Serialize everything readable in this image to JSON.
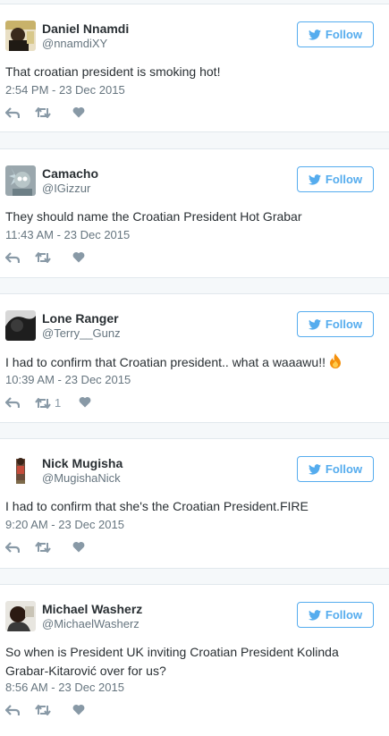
{
  "follow_label": "Follow",
  "colors": {
    "accent": "#55acee",
    "text": "#292f33",
    "muted": "#66757f",
    "icon": "#8899a6",
    "flame": "#f4900c"
  },
  "tweets": [
    {
      "name": "Daniel Nnamdi",
      "handle": "@nnamdiXY",
      "text": "That croatian president is smoking hot!",
      "time": "2:54 PM - 23 Dec 2015",
      "retweets": "",
      "avatar": "avatar-daniel"
    },
    {
      "name": "Camacho",
      "handle": "@IGizzur",
      "text": "They should name the Croatian President Hot Grabar",
      "time": "11:43 AM - 23 Dec 2015",
      "retweets": "",
      "avatar": "avatar-camacho"
    },
    {
      "name": "Lone Ranger",
      "handle": "@Terry__Gunz",
      "text": "I had to confirm that Croatian president.. what a waaawu!!",
      "emoji": "fire-emoji",
      "time": "10:39 AM - 23 Dec 2015",
      "retweets": "1",
      "avatar": "avatar-lone-ranger"
    },
    {
      "name": "Nick Mugisha",
      "handle": "@MugishaNick",
      "text": "I had to confirm that she's the Croatian President.FIRE",
      "time": "9:20 AM - 23 Dec 2015",
      "retweets": "",
      "avatar": "avatar-nick"
    },
    {
      "name": "Michael Washerz",
      "handle": "@MichaelWasherz",
      "text": "So when is President UK inviting Croatian President Kolinda Grabar-Kitarović over for us?",
      "time": "8:56 AM - 23 Dec 2015",
      "retweets": "",
      "avatar": "avatar-michael"
    }
  ]
}
